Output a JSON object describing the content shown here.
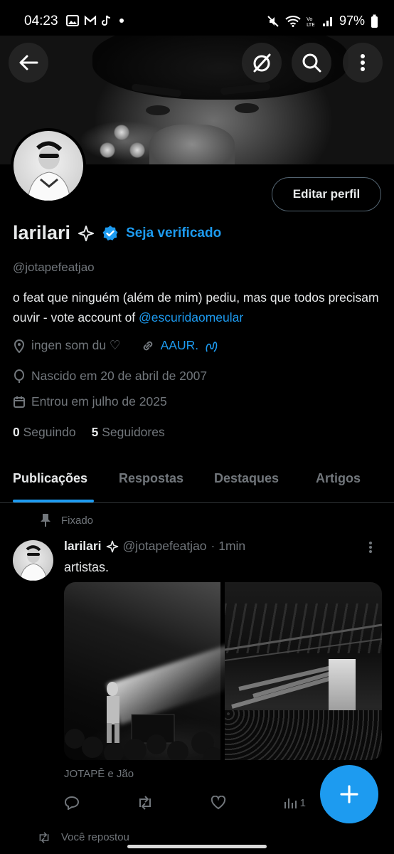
{
  "status_bar": {
    "time": "04:23",
    "battery": "97%"
  },
  "profile": {
    "edit_button": "Editar perfil",
    "name": "larilari",
    "verify_link": "Seja verificado",
    "handle": "@jotapefeatjao",
    "bio_text": "o feat que ninguém (além de mim) pediu, mas que todos precisam ouvir - vote account of ",
    "bio_mention": "@escuridaomeular",
    "location": "ingen som du ♡",
    "website": "AAUR.",
    "birthday": "Nascido em 20 de abril de 2007",
    "joined": "Entrou em julho de 2025",
    "following_count": "0",
    "following_label": "Seguindo",
    "followers_count": "5",
    "followers_label": "Seguidores"
  },
  "tabs": [
    {
      "label": "Publicações",
      "active": true
    },
    {
      "label": "Respostas"
    },
    {
      "label": "Destaques"
    },
    {
      "label": "Artigos"
    }
  ],
  "post": {
    "pinned_label": "Fixado",
    "name": "larilari",
    "handle": "@jotapefeatjao",
    "time": "· 1min",
    "text": "artistas.",
    "media_caption": "JOTAPÊ e Jão",
    "views": "1"
  },
  "next_post": {
    "label": "Você repostou"
  },
  "icons": {
    "back": "arrow-left-icon",
    "grok": "slash-circle-icon",
    "search": "search-icon",
    "more": "more-vertical-icon",
    "fab": "plus-icon"
  },
  "colors": {
    "accent": "#1d9bf0",
    "background": "#000000",
    "muted": "#71767b"
  }
}
